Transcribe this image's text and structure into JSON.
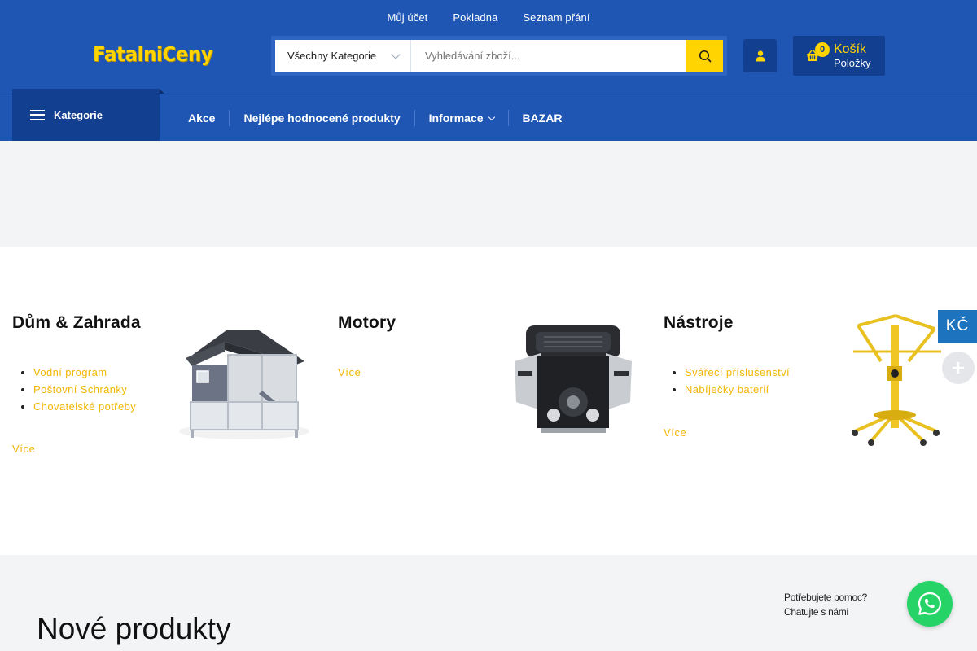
{
  "header": {
    "top_links": [
      "Můj účet",
      "Pokladna",
      "Seznam přání"
    ],
    "logo": "FatalniCeny",
    "search": {
      "category": "Všechny Kategorie",
      "placeholder": "Vyhledávání zboží..."
    },
    "cart": {
      "count": "0",
      "title": "Košík",
      "subtitle": "Položky"
    },
    "colors": {
      "primary": "#1f56b4",
      "dark": "#133f91",
      "accent": "#ffd400"
    }
  },
  "nav": {
    "categories_label": "Kategorie",
    "items": [
      "Akce",
      "Nejlépe hodnocené produkty",
      "Informace",
      "BAZAR"
    ]
  },
  "categories": [
    {
      "title": "Dům & Zahrada",
      "links": [
        "Vodní program",
        "Poštovní Schránky",
        "Chovatelské potřeby"
      ],
      "more": "Více",
      "image_icon": "chicken-coop-image"
    },
    {
      "title": "Motory",
      "links": [],
      "more": "Více",
      "image_icon": "engine-image"
    },
    {
      "title": "Nástroje",
      "links": [
        "Svářecí příslušenství",
        "Nabíječky baterií"
      ],
      "more": "Více",
      "image_icon": "drywall-lift-image"
    }
  ],
  "currency": "KČ",
  "section_title": "Nové produkty",
  "help": {
    "line1": "Potřebujete pomoc?",
    "line2": "Chatujte s námi"
  }
}
